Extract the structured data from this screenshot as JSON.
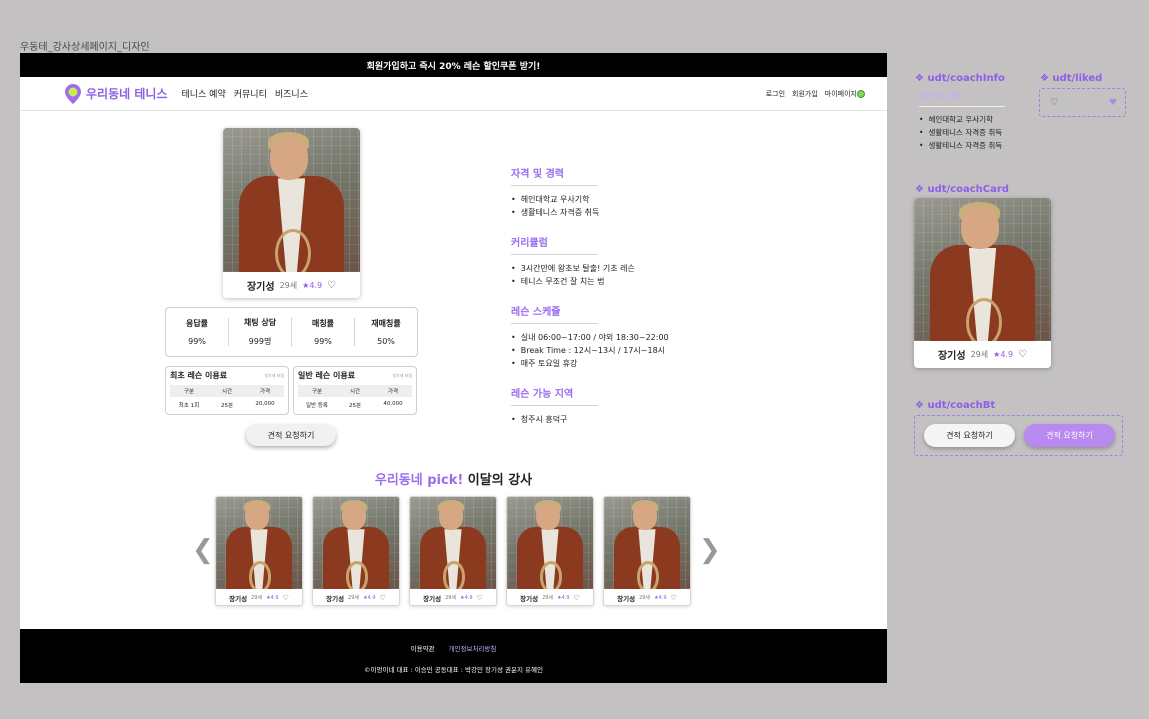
{
  "frame_title": "우동테_강사상세페이지_디자인",
  "banner": "회원가입하고 즉시 20% 레슨 할인쿠폰 받기!",
  "nav": {
    "logo": "우리동네 테니스",
    "menu": [
      "테니스 예약",
      "커뮤니티",
      "비즈니스"
    ],
    "auth": [
      "로그인",
      "회원가입",
      "마이페이지"
    ]
  },
  "coach": {
    "name": "장기성",
    "age": "29세",
    "rating": "★4.9",
    "heart": "♡"
  },
  "stats": [
    {
      "label": "응답률",
      "value": "99%"
    },
    {
      "label": "채팅 상담",
      "value": "999명"
    },
    {
      "label": "매칭률",
      "value": "99%"
    },
    {
      "label": "재매칭률",
      "value": "50%"
    }
  ],
  "fees": [
    {
      "title": "최초 레슨 이용료",
      "sub": "부가세 포함",
      "headers": [
        "구분",
        "시간",
        "가격"
      ],
      "row": [
        "최초 1회",
        "25분",
        "20,000"
      ]
    },
    {
      "title": "일반 레슨 이용료",
      "sub": "부가세 포함",
      "headers": [
        "구분",
        "시간",
        "가격"
      ],
      "row": [
        "일반 등록",
        "25분",
        "40,000"
      ]
    }
  ],
  "quote_button": "견적 요청하기",
  "info_sections": [
    {
      "title": "자격 및 경력",
      "items": [
        "헤인대학교 우사기학",
        "생활테니스 자격증 취득"
      ]
    },
    {
      "title": "커리큘럼",
      "items": [
        "3시간만에 왕초보 탈출! 기초 레슨",
        "테니스 무조건 잘 치는 법"
      ]
    },
    {
      "title": "레슨 스케쥴",
      "items": [
        "실내 06:00~17:00 / 야외 18:30~22:00",
        "Break Time : 12시~13시 / 17시~18시",
        "매주 토요일 휴강"
      ]
    },
    {
      "title": "레슨 가능 지역",
      "items": [
        "청주시 흥덕구"
      ]
    }
  ],
  "pick": {
    "highlight": "우리동네 pick!",
    "rest": " 이달의 강사"
  },
  "arrows": {
    "left": "❮",
    "right": "❯"
  },
  "footer": {
    "terms": "이용약관",
    "privacy": "개인정보처리방침",
    "copyright": "©이엉이네     대표 : 이승민     공동대표 : 박강민 장기성 권윤지 유혜인"
  },
  "components": {
    "coach_info": {
      "label": "❖ udt/coachInfo",
      "title": "자격 및 경력",
      "items": [
        "헤인대학교 우사기학",
        "생활테니스 자격증 취득",
        "생활테니스 자격증 취득"
      ]
    },
    "liked": {
      "label": "❖ udt/liked",
      "empty": "♡",
      "filled": "♥"
    },
    "coach_card": {
      "label": "❖ udt/coachCard"
    },
    "coach_bt": {
      "label": "❖ udt/coachBt",
      "white": "견적 요청하기",
      "purple": "견적 요청하기"
    }
  },
  "colors": {
    "accent": "#9a6cef",
    "banner_bg": "#000000",
    "canvas_bg": "#c3c1c1"
  }
}
